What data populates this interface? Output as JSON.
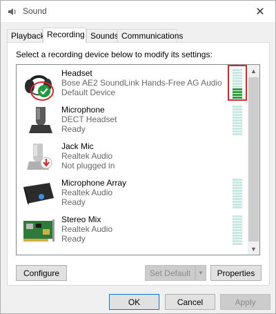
{
  "window": {
    "title": "Sound",
    "close_glyph": "✕"
  },
  "tabs": [
    {
      "label": "Playback",
      "active": false
    },
    {
      "label": "Recording",
      "active": true
    },
    {
      "label": "Sounds",
      "active": false
    },
    {
      "label": "Communications",
      "active": false
    }
  ],
  "instruction": "Select a recording device below to modify its settings:",
  "devices": [
    {
      "name": "Headset",
      "line1": "Bose AE2 SoundLink Hands-Free AG Audio",
      "line2": "Default Device",
      "icon": "headset-icon",
      "badge": "default-check-badge",
      "meter_level": 0.36,
      "highlighted": true
    },
    {
      "name": "Microphone",
      "line1": "DECT Headset",
      "line2": "Ready",
      "icon": "microphone-icon",
      "badge": null,
      "meter_level": 0,
      "highlighted": false
    },
    {
      "name": "Jack Mic",
      "line1": "Realtek Audio",
      "line2": "Not plugged in",
      "icon": "jack-mic-icon",
      "badge": "unplugged-badge",
      "meter_level": null,
      "highlighted": false
    },
    {
      "name": "Microphone Array",
      "line1": "Realtek Audio",
      "line2": "Ready",
      "icon": "microphone-array-icon",
      "badge": null,
      "meter_level": 0,
      "highlighted": false
    },
    {
      "name": "Stereo Mix",
      "line1": "Realtek Audio",
      "line2": "Ready",
      "icon": "stereo-mix-icon",
      "badge": null,
      "meter_level": 0,
      "highlighted": false
    }
  ],
  "buttons": {
    "configure": "Configure",
    "set_default": "Set Default",
    "properties": "Properties",
    "ok": "OK",
    "cancel": "Cancel",
    "apply": "Apply"
  },
  "colors": {
    "meter_on": "#2e9b3e",
    "meter_off": "#c8e6e2",
    "highlight": "#d9262c",
    "default_badge": "#1e9b3a"
  }
}
